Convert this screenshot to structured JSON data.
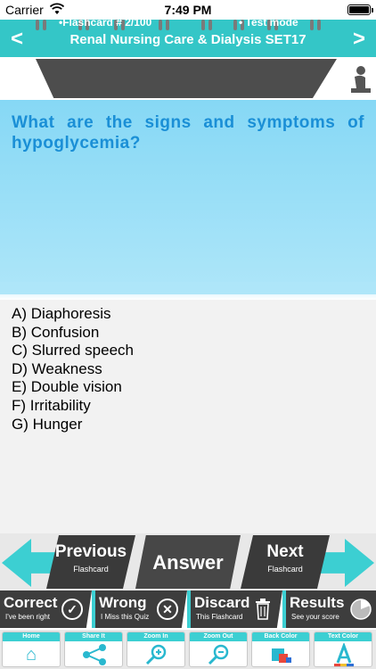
{
  "status_bar": {
    "carrier": "Carrier",
    "time": "7:49 PM"
  },
  "header": {
    "title": "Renal Nursing Care & Dialysis SET17",
    "back": "<",
    "forward": ">"
  },
  "info": {
    "flashcard": "•Flashcard #  2/100",
    "mode": "• Test mode"
  },
  "question": {
    "text": "What are the signs and symptoms of hypoglycemia?"
  },
  "answers": [
    "A) Diaphoresis",
    "B) Confusion",
    "C) Slurred speech",
    "D) Weakness",
    "E) Double vision",
    "F) Irritability",
    "G) Hunger"
  ],
  "nav": {
    "previous": "Previous",
    "previous_sub": "Flashcard",
    "answer": "Answer",
    "next": "Next",
    "next_sub": "Flashcard"
  },
  "actions": {
    "correct": "Correct",
    "correct_sub": "I've been right",
    "wrong": "Wrong",
    "wrong_sub": "I Miss this Quiz",
    "discard": "Discard",
    "discard_sub": "This Flashcard",
    "results": "Results",
    "results_sub": "See your score"
  },
  "toolbar": {
    "home": "Home",
    "share": "Share It",
    "zoom_in": "Zoom In",
    "zoom_out": "Zoom Out",
    "back_color": "Back Color",
    "text_color": "Text Color"
  },
  "colors": {
    "accent": "#34c6c7",
    "question_text": "#1a8fd6",
    "question_bg": "#86d8f5",
    "dark": "#3a3a3a"
  },
  "icons": [
    "wifi-icon",
    "battery-icon",
    "person-icon",
    "check-icon",
    "close-icon",
    "trash-icon",
    "pie-icon",
    "home-icon",
    "share-icon",
    "zoom-in-icon",
    "zoom-out-icon",
    "palette-icon",
    "text-color-icon"
  ]
}
